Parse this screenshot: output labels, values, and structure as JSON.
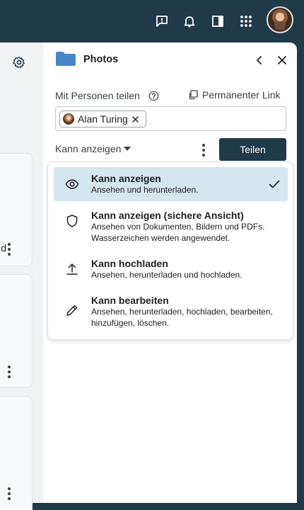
{
  "topbar": {
    "icons": [
      "feedback-icon",
      "bell-icon",
      "panel-icon",
      "apps-grid-icon"
    ],
    "avatar": "user-avatar"
  },
  "background_app": {
    "settings_icon": "gear-icon",
    "partial_text": "d"
  },
  "panel": {
    "title": "Photos",
    "folder_color": "#4a86c5",
    "share_with_people_label": "Mit Personen teilen",
    "help_icon": "help-circle-icon",
    "permanent_link_label": "Permanenter Link",
    "chips": [
      {
        "name": "Alan Turing"
      }
    ],
    "permission_dropdown_label": "Kann anzeigen",
    "share_button_label": "Teilen",
    "accent_color": "#1f3a48"
  },
  "permission_menu": {
    "items": [
      {
        "title": "Kann anzeigen",
        "description": "Ansehen und herunterladen.",
        "icon": "eye-icon",
        "selected": true
      },
      {
        "title": "Kann anzeigen (sichere Ansicht)",
        "description": "Ansehen von Dokumenten, Bildern und PDFs. Wasserzeichen werden angewendet.",
        "icon": "shield-icon",
        "selected": false
      },
      {
        "title": "Kann hochladen",
        "description": "Ansehen, herunterladen und hochladen.",
        "icon": "upload-icon",
        "selected": false
      },
      {
        "title": "Kann bearbeiten",
        "description": "Ansehen, herunterladen, hochladen, bearbeiten, hinzufügen, löschen.",
        "icon": "pencil-icon",
        "selected": false
      }
    ],
    "selected_color": "#d4e6ee"
  }
}
